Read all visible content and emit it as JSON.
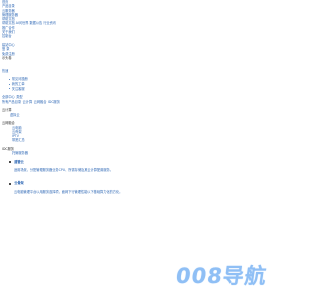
{
  "nav": [
    "首页",
    "产品目录",
    "云服务器",
    "管理服务器",
    "帮助文档",
    "帮助文档 AI问世界 数据公告 行业资讯",
    "推广合作",
    "关于我们",
    "控制台"
  ],
  "user": {
    "center": "建站中心",
    "login": "登 录",
    "register": "免费注册",
    "title": "示头卷"
  },
  "section_link": "热速",
  "guide_items": [
    "常见问题册",
    "我的工单",
    "关注客服"
  ],
  "categories": {
    "items": [
      "全部中心",
      "类型"
    ],
    "row2": [
      "所有产品目录",
      "云计算",
      "云网融合",
      "IDC服务"
    ]
  },
  "cloud_compute": {
    "title": "云计算",
    "items": [
      "虚拟云"
    ]
  },
  "cloud_network": {
    "title": "云网融合",
    "items": [
      "云电脑",
      "云骨架",
      "IPTV",
      "带宽汇总"
    ]
  },
  "idc": {
    "title": "IDC服务",
    "items": [
      "托管服务器"
    ]
  },
  "cards": [
    {
      "title": "建管云",
      "desc": "适用场景，分配管理服务器业务CPU、所需存储及其云计算配置服务。"
    },
    {
      "title": "云骨架",
      "desc": "云电脑管理平台以用服务选择项，面网下行管理性能以下基础算力化的方化。"
    }
  ],
  "watermark": "008导航"
}
